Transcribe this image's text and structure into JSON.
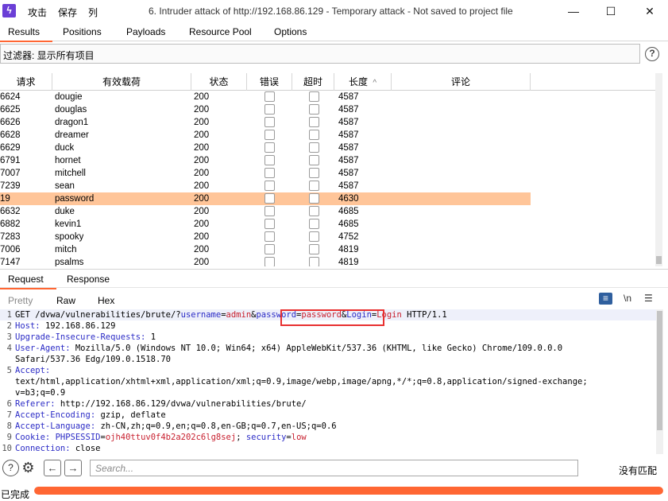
{
  "titlebar": {
    "menu": [
      "攻击",
      "保存",
      "列"
    ],
    "title": "6. Intruder attack of http://192.168.86.129 - Temporary attack - Not saved to project file",
    "minimize": "—",
    "maximize": "☐",
    "close": "✕"
  },
  "tabs": [
    "Results",
    "Positions",
    "Payloads",
    "Resource Pool",
    "Options"
  ],
  "filter": {
    "label": "过滤器: 显示所有项目"
  },
  "help_glyph": "?",
  "table": {
    "headers": [
      "请求",
      "有效载荷",
      "状态",
      "错误",
      "超时",
      "长度",
      "评论"
    ],
    "sort_indicator": "^",
    "rows": [
      {
        "req": "6624",
        "payload": "dougie",
        "status": "200",
        "length": "4587"
      },
      {
        "req": "6625",
        "payload": "douglas",
        "status": "200",
        "length": "4587"
      },
      {
        "req": "6626",
        "payload": "dragon1",
        "status": "200",
        "length": "4587"
      },
      {
        "req": "6628",
        "payload": "dreamer",
        "status": "200",
        "length": "4587"
      },
      {
        "req": "6629",
        "payload": "duck",
        "status": "200",
        "length": "4587"
      },
      {
        "req": "6791",
        "payload": "hornet",
        "status": "200",
        "length": "4587"
      },
      {
        "req": "7007",
        "payload": "mitchell",
        "status": "200",
        "length": "4587"
      },
      {
        "req": "7239",
        "payload": "sean",
        "status": "200",
        "length": "4587"
      },
      {
        "req": "19",
        "payload": "password",
        "status": "200",
        "length": "4630"
      },
      {
        "req": "6632",
        "payload": "duke",
        "status": "200",
        "length": "4685"
      },
      {
        "req": "6882",
        "payload": "kevin1",
        "status": "200",
        "length": "4685"
      },
      {
        "req": "7283",
        "payload": "spooky",
        "status": "200",
        "length": "4752"
      },
      {
        "req": "7006",
        "payload": "mitch",
        "status": "200",
        "length": "4819"
      },
      {
        "req": "7147",
        "payload": "psalms",
        "status": "200",
        "length": "4819"
      }
    ],
    "selected_index": 8,
    "selected_color": "#ffc599"
  },
  "rr_tabs": [
    "Request",
    "Response"
  ],
  "sub_tabs": [
    "Pretty",
    "Raw",
    "Hex"
  ],
  "editor_tools": {
    "wrap": "≡",
    "newline": "\\n",
    "menu": "☰"
  },
  "request_lines": [
    {
      "n": "1",
      "segs": [
        [
          "plain",
          "GET /dvwa/vulnerabilities/brute/?"
        ],
        [
          "k",
          "username"
        ],
        [
          "plain",
          "="
        ],
        [
          "v",
          "admin"
        ],
        [
          "plain",
          "&"
        ],
        [
          "k",
          "password"
        ],
        [
          "plain",
          "="
        ],
        [
          "v",
          "password"
        ],
        [
          "plain",
          "&"
        ],
        [
          "k",
          "Login"
        ],
        [
          "plain",
          "="
        ],
        [
          "v",
          "Login"
        ],
        [
          "plain",
          " HTTP/1.1"
        ]
      ]
    },
    {
      "n": "2",
      "segs": [
        [
          "k",
          "Host: "
        ],
        [
          "plain",
          "192.168.86.129"
        ]
      ]
    },
    {
      "n": "3",
      "segs": [
        [
          "k",
          "Upgrade-Insecure-Requests: "
        ],
        [
          "plain",
          "1"
        ]
      ]
    },
    {
      "n": "4",
      "segs": [
        [
          "k",
          "User-Agent: "
        ],
        [
          "plain",
          "Mozilla/5.0 (Windows NT 10.0; Win64; x64) AppleWebKit/537.36 (KHTML, like Gecko) Chrome/109.0.0.0"
        ]
      ]
    },
    {
      "n": "",
      "segs": [
        [
          "plain",
          "Safari/537.36 Edg/109.0.1518.70"
        ]
      ]
    },
    {
      "n": "5",
      "segs": [
        [
          "k",
          "Accept: "
        ]
      ]
    },
    {
      "n": "",
      "segs": [
        [
          "plain",
          "text/html,application/xhtml+xml,application/xml;q=0.9,image/webp,image/apng,*/*;q=0.8,application/signed-exchange;"
        ]
      ]
    },
    {
      "n": "",
      "segs": [
        [
          "plain",
          "v=b3;q=0.9"
        ]
      ]
    },
    {
      "n": "6",
      "segs": [
        [
          "k",
          "Referer: "
        ],
        [
          "plain",
          "http://192.168.86.129/dvwa/vulnerabilities/brute/"
        ]
      ]
    },
    {
      "n": "7",
      "segs": [
        [
          "k",
          "Accept-Encoding: "
        ],
        [
          "plain",
          "gzip, deflate"
        ]
      ]
    },
    {
      "n": "8",
      "segs": [
        [
          "k",
          "Accept-Language: "
        ],
        [
          "plain",
          "zh-CN,zh;q=0.9,en;q=0.8,en-GB;q=0.7,en-US;q=0.6"
        ]
      ]
    },
    {
      "n": "9",
      "segs": [
        [
          "k",
          "Cookie: "
        ],
        [
          "k",
          "PHPSESSID"
        ],
        [
          "plain",
          "="
        ],
        [
          "v",
          "ojh40ttuv0f4b2a202c6lg8sej"
        ],
        [
          "plain",
          "; "
        ],
        [
          "k",
          "security"
        ],
        [
          "plain",
          "="
        ],
        [
          "v",
          "low"
        ]
      ]
    },
    {
      "n": "10",
      "segs": [
        [
          "k",
          "Connection: "
        ],
        [
          "plain",
          "close"
        ]
      ]
    }
  ],
  "search": {
    "placeholder": "Search...",
    "no_match": "没有匹配",
    "help": "?",
    "settings": "⚙",
    "prev": "←",
    "next": "→"
  },
  "status": {
    "text": "已完成",
    "progress": 1.0,
    "progress_color": "#ff6633"
  }
}
